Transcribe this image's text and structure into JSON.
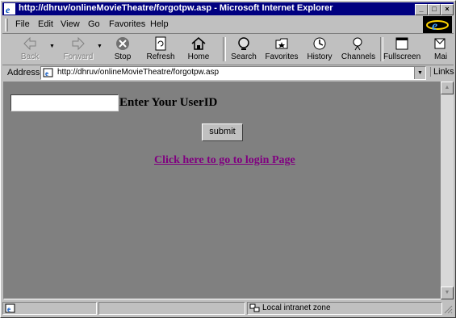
{
  "window": {
    "title": "http://dhruv/onlineMovieTheatre/forgotpw.asp - Microsoft Internet Explorer"
  },
  "menu": {
    "items": [
      "File",
      "Edit",
      "View",
      "Go",
      "Favorites",
      "Help"
    ]
  },
  "toolbar": {
    "buttons": [
      {
        "label": "Back",
        "icon": "back-arrow-icon",
        "enabled": false
      },
      {
        "label": "Forward",
        "icon": "forward-arrow-icon",
        "enabled": false
      },
      {
        "label": "Stop",
        "icon": "stop-icon",
        "enabled": true
      },
      {
        "label": "Refresh",
        "icon": "refresh-icon",
        "enabled": true
      },
      {
        "label": "Home",
        "icon": "home-icon",
        "enabled": true
      },
      {
        "label": "Search",
        "icon": "search-icon",
        "enabled": true
      },
      {
        "label": "Favorites",
        "icon": "favorites-icon",
        "enabled": true
      },
      {
        "label": "History",
        "icon": "history-icon",
        "enabled": true
      },
      {
        "label": "Channels",
        "icon": "channels-icon",
        "enabled": true
      },
      {
        "label": "Fullscreen",
        "icon": "fullscreen-icon",
        "enabled": true
      },
      {
        "label": "Mai",
        "icon": "mail-icon",
        "enabled": true
      }
    ]
  },
  "address": {
    "label": "Address",
    "url": "http://dhruv/onlineMovieTheatre/forgotpw.asp",
    "links_label": "Links"
  },
  "page": {
    "userid_value": "",
    "userid_label": "Enter Your UserID",
    "submit_label": "submit",
    "login_link": "Click here to go to login Page"
  },
  "status": {
    "zone": "Local intranet zone"
  },
  "colors": {
    "titlebar": "#000080",
    "content_bg": "#808080",
    "chrome": "#c0c0c0",
    "link": "#800080"
  }
}
